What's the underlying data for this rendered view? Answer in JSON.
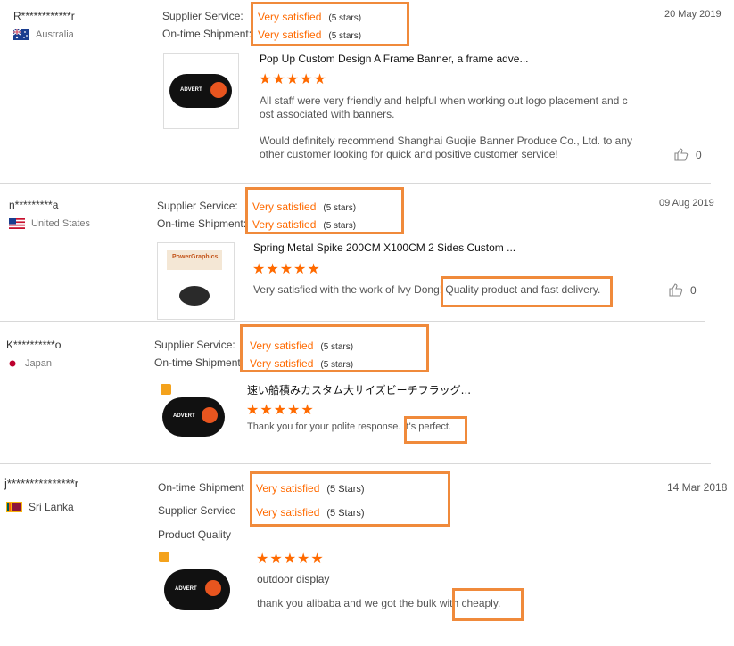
{
  "reviews": [
    {
      "buyer": "R************r",
      "country": "Australia",
      "ratings": [
        {
          "label": "Supplier Service:",
          "value": "Very satisfied",
          "stars": "(5 stars)"
        },
        {
          "label": "On-time Shipment:",
          "value": "Very satisfied",
          "stars": "(5 stars)"
        }
      ],
      "date": "20 May 2019",
      "product_title": "Pop Up Custom Design A Frame Banner, a frame adve...",
      "stars": "★★★★★",
      "comment_lines": [
        "All staff were very friendly and helpful when working out logo placement and c",
        "ost associated with banners.",
        "",
        "Would definitely recommend Shanghai Guojie Banner Produce Co., Ltd. to any",
        "other customer looking for quick and positive customer service!"
      ],
      "likes": "0"
    },
    {
      "buyer": "n*********a",
      "country": "United States",
      "ratings": [
        {
          "label": "Supplier Service:",
          "value": "Very satisfied",
          "stars": "(5 stars)"
        },
        {
          "label": "On-time Shipment:",
          "value": "Very satisfied",
          "stars": "(5 stars)"
        }
      ],
      "date": "09 Aug 2019",
      "product_title": "Spring Metal Spike 200CM X100CM 2 Sides Custom ...",
      "stars": "★★★★★",
      "comment": "Very satisfied with the work of Ivy Dong! Quality product and fast delivery.",
      "likes": "0"
    },
    {
      "buyer": "K**********o",
      "country": "Japan",
      "ratings": [
        {
          "label": "Supplier Service:",
          "value": "Very satisfied",
          "stars": "(5 stars)"
        },
        {
          "label": "On-time Shipment",
          "value": "Very satisfied",
          "stars": "(5 stars)"
        }
      ],
      "product_title": "速い船積みカスタム大サイズビーチフラッグ...",
      "stars": "★★★★★",
      "comment": "Thank you for your polite response. It's perfect."
    },
    {
      "buyer": "j***************r",
      "country": "Sri Lanka",
      "ratings": [
        {
          "label": "On-time Shipment",
          "value": "Very satisfied",
          "stars": "(5 Stars)"
        },
        {
          "label": "Supplier Service",
          "value": "Very satisfied",
          "stars": "(5 Stars)"
        },
        {
          "label": "Product Quality",
          "value": "",
          "stars": ""
        }
      ],
      "date": "14 Mar 2018",
      "stars": "★★★★★",
      "product_title": "outdoor display",
      "comment": "thank you alibaba and we got the bulk with cheaply."
    }
  ],
  "colors": {
    "accent": "#ff6a00",
    "highlight_box": "#f08a3b"
  },
  "icons": {
    "like": "thumbs-up-icon",
    "flag": "country-flag-icon"
  }
}
